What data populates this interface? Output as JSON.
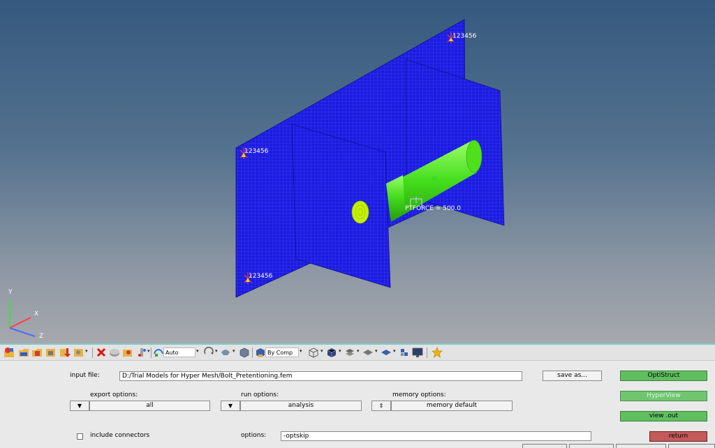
{
  "viewport": {
    "constraint_labels": [
      "123456",
      "123456",
      "123456"
    ],
    "force_label": "PTFORCE = 500.0",
    "mass_label": "M",
    "triad": {
      "y": "Y",
      "x": "X",
      "z": "Z"
    },
    "colors": {
      "mesh": "#1c1ce0",
      "mesh_line": "#5a5aff",
      "bolt": "#4fe01c",
      "bolt_head": "#c8f000",
      "constraint": "#ff3b3b",
      "background_top": "#35597f",
      "background_bottom": "#a6a8ad"
    }
  },
  "toolbar": {
    "icons": [
      "open-model-icon",
      "open-file-icon",
      "save-model-icon",
      "import-icon",
      "export-icon",
      "save-image-icon",
      "delete-icon",
      "mask-icon",
      "unmask-icon",
      "find-icon",
      "visualization-auto-icon",
      "rotate-icon",
      "pan-icon",
      "box-view-icon",
      "by-comp-icon",
      "wireframe-icon",
      "shaded-icon",
      "layer-icon",
      "plane-icon",
      "surface-icon",
      "element-icon",
      "screen-icon",
      "favorite-star-icon"
    ],
    "shading_mode": "Auto",
    "color_mode": "By Comp"
  },
  "panel": {
    "input_file_label": "input file:",
    "input_file_value": "D:/Trial Models for Hyper Mesh/Bolt_Pretentioning.fem",
    "save_as_label": "save as...",
    "export_options_label": "export options:",
    "export_options_value": "all",
    "run_options_label": "run options:",
    "run_options_value": "analysis",
    "memory_options_label": "memory options:",
    "memory_options_value": "memory default",
    "include_connectors_label": "include connectors",
    "options_label": "options:",
    "options_value": "-optskip",
    "optistruct_button": "OptiStruct",
    "hyperview_button": "HyperView",
    "view_out_button": "view .out",
    "return_button": "return"
  }
}
